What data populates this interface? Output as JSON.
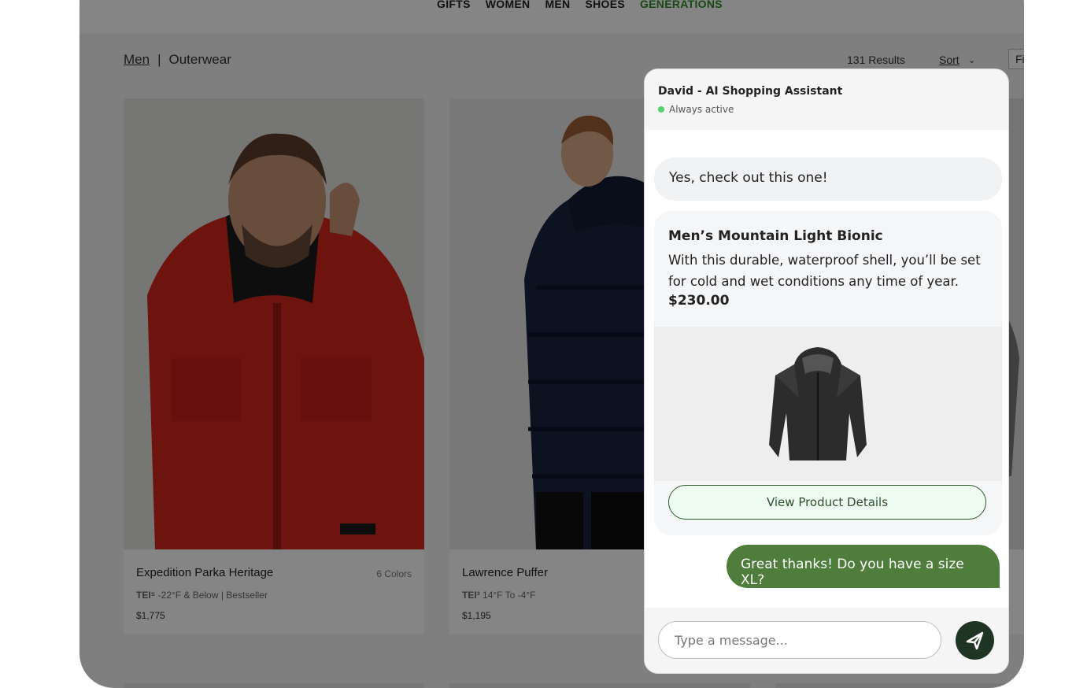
{
  "nav": {
    "links": [
      "GIFTS",
      "WOMEN",
      "MEN",
      "SHOES",
      "GENERATIONS"
    ]
  },
  "breadcrumb": {
    "parent": "Men",
    "separator": "|",
    "current": "Outerwear"
  },
  "toolbar": {
    "results": "131 Results",
    "sort": "Sort",
    "filter": "Fi"
  },
  "products": [
    {
      "name": "Expedition Parka Heritage",
      "colors": "6 Colors",
      "tei_label": "TEI⁵",
      "tei_text": "-22°F & Below | Bestseller",
      "price": "$1,775"
    },
    {
      "name": "Lawrence Puffer",
      "colors": "",
      "tei_label": "TEI³",
      "tei_text": "14°F To -4°F",
      "price": "$1,195"
    }
  ],
  "chat": {
    "title": "David - AI Shopping Assistant",
    "status": "Always active",
    "bot_message": "Yes, check out this one!",
    "product": {
      "name": "Men’s Mountain Light Bionic",
      "description": "With this durable, waterproof shell, you’ll be set for cold and wet conditions any time of year.",
      "price": "$230.00",
      "button": "View Product Details"
    },
    "user_message": "Great thanks! Do you have a size XL?",
    "input_placeholder": "Type a message..."
  },
  "colors": {
    "accent_green": "#4e7d3c",
    "send_button": "#1f3423",
    "status_dot": "#55d16a",
    "nav_accent": "#2f8a25"
  }
}
